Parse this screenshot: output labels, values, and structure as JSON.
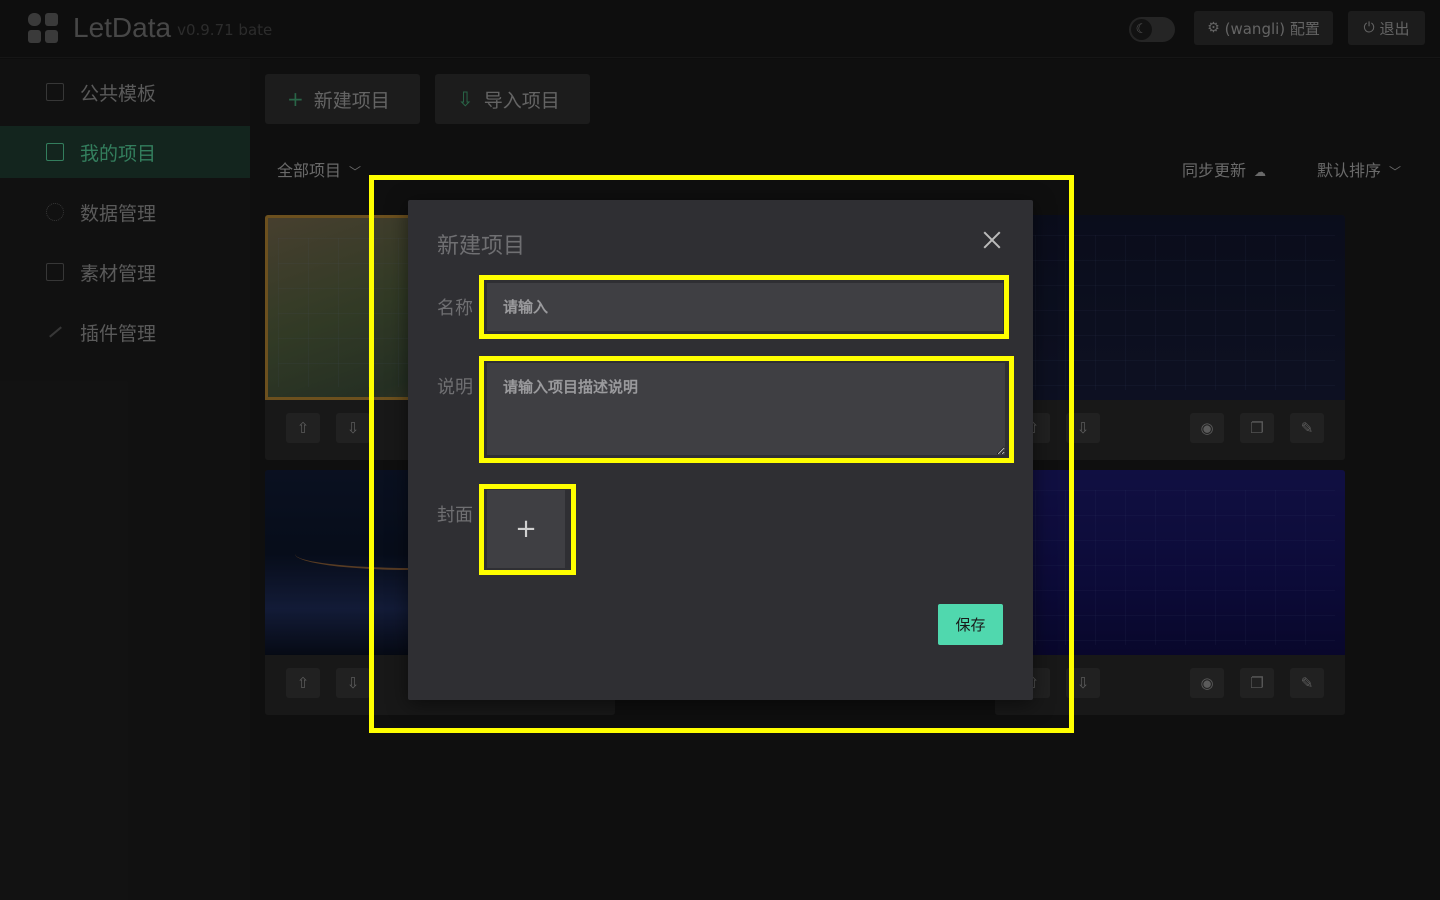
{
  "app": {
    "name": "LetData",
    "version": "v0.9.71 bate"
  },
  "header": {
    "config_label": "(wangli) 配置",
    "logout_label": "退出",
    "theme_icon": "moon-icon"
  },
  "sidebar": {
    "items": [
      {
        "label": "公共模板",
        "icon": "store-icon"
      },
      {
        "label": "我的项目",
        "icon": "folder-icon",
        "active": true
      },
      {
        "label": "数据管理",
        "icon": "data-icon"
      },
      {
        "label": "素材管理",
        "icon": "file-icon"
      },
      {
        "label": "插件管理",
        "icon": "rocket-icon"
      }
    ]
  },
  "main": {
    "new_project_label": "新建项目",
    "import_project_label": "导入项目",
    "filter_label": "全部项目",
    "sync_label": "同步更新",
    "sort_label": "默认排序"
  },
  "modal": {
    "title": "新建项目",
    "name_label": "名称",
    "name_placeholder": "请输入",
    "desc_label": "说明",
    "desc_placeholder": "请输入项目描述说明",
    "cover_label": "封面",
    "upload_symbol": "+",
    "save_label": "保存"
  },
  "colors": {
    "accent": "#50d8ae",
    "active_nav": "#4fc28f",
    "highlight": "#ffff00"
  }
}
